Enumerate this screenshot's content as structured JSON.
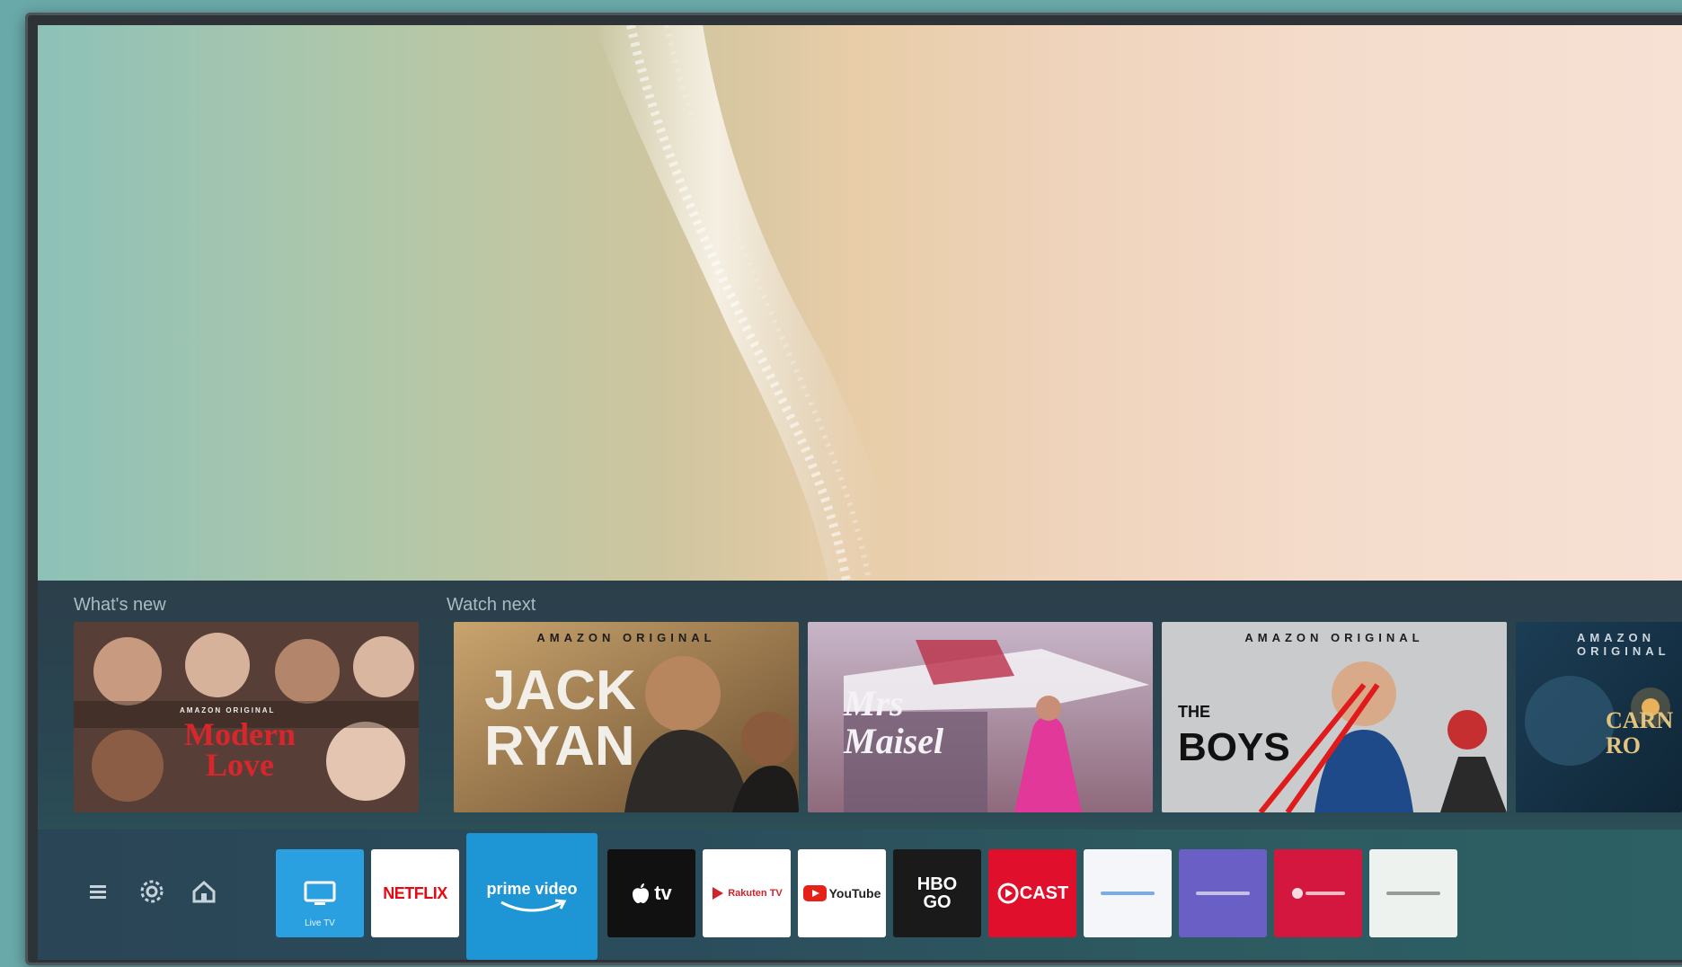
{
  "rows": {
    "whats_new_label": "What's new",
    "watch_next_label": "Watch next",
    "tiles": [
      {
        "name": "modern-love",
        "tag": "AMAZON ORIGINAL",
        "title_line1": "Modern",
        "title_line2": "Love"
      },
      {
        "name": "jack-ryan",
        "tag": "AMAZON ORIGINAL",
        "title_line1": "JACK",
        "title_line2": "RYAN"
      },
      {
        "name": "marvelous-mrs-maisel",
        "tag": "",
        "title_line1": "Mrs",
        "title_line2": "Maisel"
      },
      {
        "name": "the-boys",
        "tag": "AMAZON ORIGINAL",
        "title_line1": "THE",
        "title_line2": "BOYS"
      },
      {
        "name": "carnival-row",
        "tag": "AMAZON ORIGINAL",
        "title_line1": "CARN",
        "title_line2": "RO"
      }
    ]
  },
  "system_icons": [
    "menu-icon",
    "settings-gear-icon",
    "home-icon"
  ],
  "apps": [
    {
      "name": "live-tv",
      "label": "Live TV",
      "bg": "#2aa0e0",
      "color": "#ffffff",
      "icon": "tv-icon"
    },
    {
      "name": "netflix",
      "label": "NETFLIX",
      "bg": "#ffffff",
      "color": "#e50914"
    },
    {
      "name": "prime-video",
      "label": "prime video",
      "bg": "#1e96d6",
      "color": "#ffffff",
      "focused": true
    },
    {
      "name": "apple-tv",
      "label": "tv",
      "bg": "#111111",
      "color": "#ffffff",
      "icon": "apple-icon"
    },
    {
      "name": "rakuten-tv",
      "label": "Rakuten TV",
      "bg": "#ffffff",
      "color": "#d2232a",
      "icon": "play-icon"
    },
    {
      "name": "youtube",
      "label": "YouTube",
      "bg": "#ffffff",
      "color": "#222222",
      "icon": "youtube-play-icon"
    },
    {
      "name": "hbo-go",
      "label": "HBO GO",
      "bg": "#1a1a1a",
      "color": "#ffffff"
    },
    {
      "name": "vcast",
      "label": "CAST",
      "bg": "#e0102c",
      "color": "#ffffff",
      "icon": "circle-play-icon"
    },
    {
      "name": "app-white-1",
      "label": "",
      "bg": "#f4f6f9",
      "color": "#2a7ad0"
    },
    {
      "name": "app-purple",
      "label": "",
      "bg": "#6a5fc4",
      "color": "#ffffff"
    },
    {
      "name": "app-red",
      "label": "",
      "bg": "#d3173f",
      "color": "#ffffff"
    },
    {
      "name": "app-white-2",
      "label": "",
      "bg": "#eef2ee",
      "color": "#444444"
    }
  ]
}
